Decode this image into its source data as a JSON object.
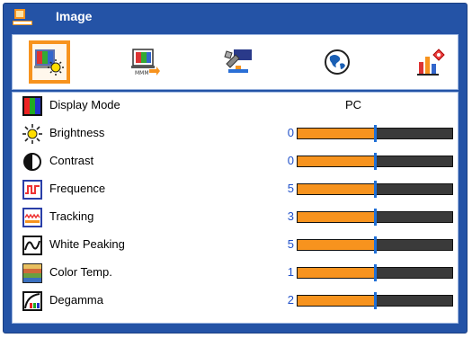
{
  "window": {
    "title": "Image"
  },
  "toolbar": {
    "tabs": [
      {
        "name": "image-settings-icon",
        "active": true
      },
      {
        "name": "screen-settings-icon",
        "active": false
      },
      {
        "name": "setting-icon",
        "active": false
      },
      {
        "name": "language-globe-icon",
        "active": false
      },
      {
        "name": "management-icon",
        "active": false
      }
    ]
  },
  "items": [
    {
      "key": "display-mode",
      "label": "Display Mode",
      "icon": "color-bars-icon",
      "value": "PC",
      "type": "text"
    },
    {
      "key": "brightness",
      "label": "Brightness",
      "icon": "sun-icon",
      "value": "0",
      "type": "slider",
      "level": 0.5
    },
    {
      "key": "contrast",
      "label": "Contrast",
      "icon": "contrast-icon",
      "value": "0",
      "type": "slider",
      "level": 0.5
    },
    {
      "key": "frequence",
      "label": "Frequence",
      "icon": "frequency-wave-icon",
      "value": "5",
      "type": "slider",
      "level": 0.5
    },
    {
      "key": "tracking",
      "label": "Tracking",
      "icon": "tracking-icon",
      "value": "3",
      "type": "slider",
      "level": 0.5
    },
    {
      "key": "white-peaking",
      "label": "White Peaking",
      "icon": "sine-wave-icon",
      "value": "5",
      "type": "slider",
      "level": 0.5
    },
    {
      "key": "color-temp",
      "label": "Color Temp.",
      "icon": "color-temp-icon",
      "value": "1",
      "type": "slider",
      "level": 0.5
    },
    {
      "key": "degamma",
      "label": "Degamma",
      "icon": "gamma-curve-icon",
      "value": "2",
      "type": "slider",
      "level": 0.5
    }
  ],
  "colors": {
    "window_blue": "#2453a6",
    "accent_orange": "#f7931e",
    "value_blue": "#2050c8",
    "marker_blue": "#1f6fd6",
    "bar_dark": "#3a3a3a"
  }
}
